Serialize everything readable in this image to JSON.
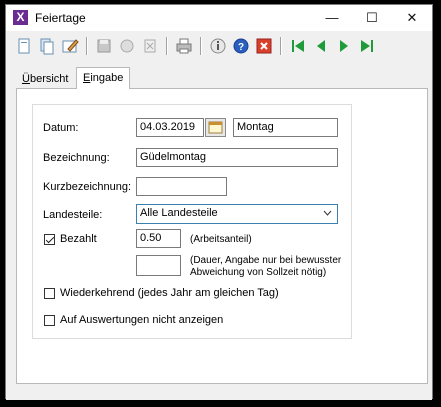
{
  "window": {
    "title": "Feiertage",
    "app_icon": "X"
  },
  "window_controls": {
    "minimize": "—",
    "maximize": "☐",
    "close": "✕"
  },
  "toolbar": {
    "icons": [
      "new-icon",
      "copy-icon",
      "edit-icon",
      "save-icon",
      "undo-icon",
      "delete-icon",
      "print-icon",
      "info-icon",
      "help-icon",
      "close-icon",
      "first-icon",
      "prev-icon",
      "next-icon",
      "last-icon"
    ]
  },
  "tabs": [
    {
      "label": "Übersicht",
      "active": false
    },
    {
      "label": "Eingabe",
      "active": true
    }
  ],
  "form": {
    "datum_label": "Datum:",
    "datum_value": "04.03.2019",
    "weekday_value": "Montag",
    "bezeichnung_label": "Bezeichnung:",
    "bezeichnung_value": "Güdelmontag",
    "kurz_label": "Kurzbezeichnung:",
    "kurz_value": "",
    "landesteile_label": "Landesteile:",
    "landesteile_value": "Alle Landesteile",
    "bezahlt_label": "Bezahlt",
    "bezahlt_checked": true,
    "anteil_value": "0.50",
    "anteil_hint": "(Arbeitsanteil)",
    "dauer_value": "",
    "dauer_hint_1": "(Dauer, Angabe nur bei bewusster",
    "dauer_hint_2": "Abweichung von Sollzeit nötig)",
    "wiederkehrend_label": "Wiederkehrend (jedes Jahr am gleichen Tag)",
    "wiederkehrend_checked": false,
    "auswertungen_label": "Auf Auswertungen nicht anzeigen",
    "auswertungen_checked": false
  }
}
